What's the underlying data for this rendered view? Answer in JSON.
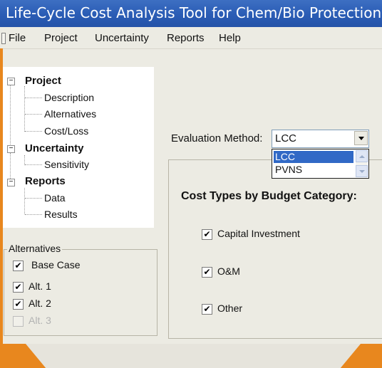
{
  "window": {
    "title": "Life-Cycle Cost Analysis Tool for Chem/Bio Protection of I"
  },
  "menu": {
    "items": [
      "File",
      "Project",
      "Uncertainty",
      "Reports",
      "Help"
    ]
  },
  "tree": {
    "groups": [
      {
        "label": "Project",
        "expander": "−",
        "children": [
          "Description",
          "Alternatives",
          "Cost/Loss"
        ]
      },
      {
        "label": "Uncertainty",
        "expander": "−",
        "children": [
          "Sensitivity"
        ]
      },
      {
        "label": "Reports",
        "expander": "−",
        "children": [
          "Data",
          "Results"
        ]
      }
    ]
  },
  "alternatives": {
    "title": "Alternatives",
    "items": [
      {
        "label": "Base Case",
        "checked": true,
        "enabled": true
      },
      {
        "label": "Alt. 1",
        "checked": true,
        "enabled": true
      },
      {
        "label": "Alt. 2",
        "checked": true,
        "enabled": true
      },
      {
        "label": "Alt. 3",
        "checked": false,
        "enabled": false
      }
    ]
  },
  "evaluation": {
    "label": "Evaluation Method:",
    "value": "LCC",
    "options": [
      "LCC",
      "PVNS"
    ],
    "selected_index": 0
  },
  "cost_types": {
    "title": "Cost Types by Budget Category:",
    "items": [
      {
        "label": "Capital Investment",
        "checked": true
      },
      {
        "label": "O&M",
        "checked": true
      },
      {
        "label": "Other",
        "checked": true
      }
    ]
  },
  "colors": {
    "titlebar": "#2a5cb5",
    "selection": "#3169c6",
    "frame": "#e8871e"
  }
}
